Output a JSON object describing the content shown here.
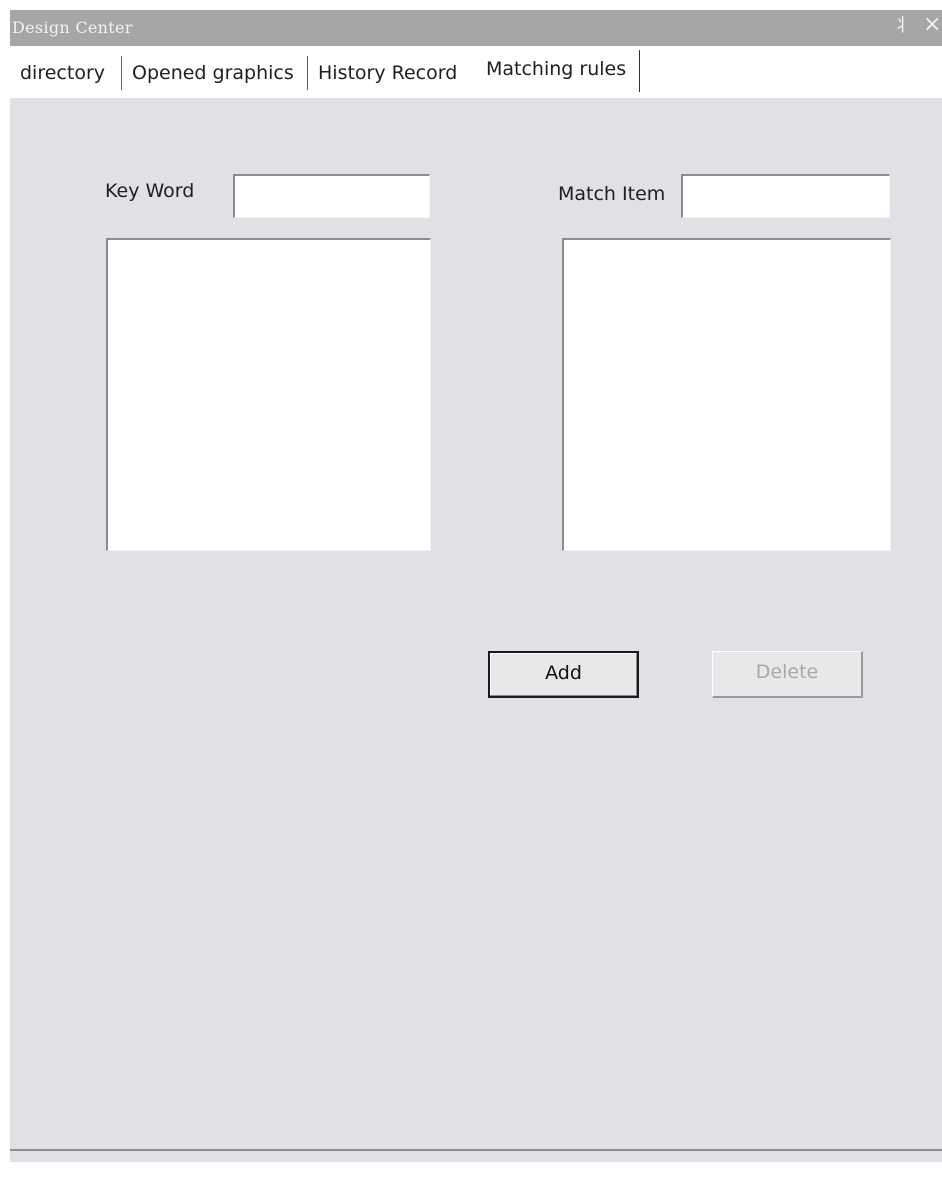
{
  "window": {
    "title": "Design Center",
    "pin_glyph": "丬",
    "close_glyph": "×"
  },
  "tabs": [
    {
      "label": "directory",
      "active": false
    },
    {
      "label": "Opened graphics",
      "active": false
    },
    {
      "label": "History Record",
      "active": false
    },
    {
      "label": "Matching rules",
      "active": true
    }
  ],
  "matching_rules": {
    "keyword_label": "Key Word",
    "keyword_value": "",
    "match_item_label": "Match Item",
    "match_item_value": "",
    "keyword_list": [],
    "match_item_list": [],
    "add_label": "Add",
    "delete_label": "Delete",
    "delete_enabled": false
  },
  "colors": {
    "panel_bg": "#e0e0e5",
    "titlebar_bg": "#a6a6a6",
    "disabled_text": "#a8a8a8"
  }
}
